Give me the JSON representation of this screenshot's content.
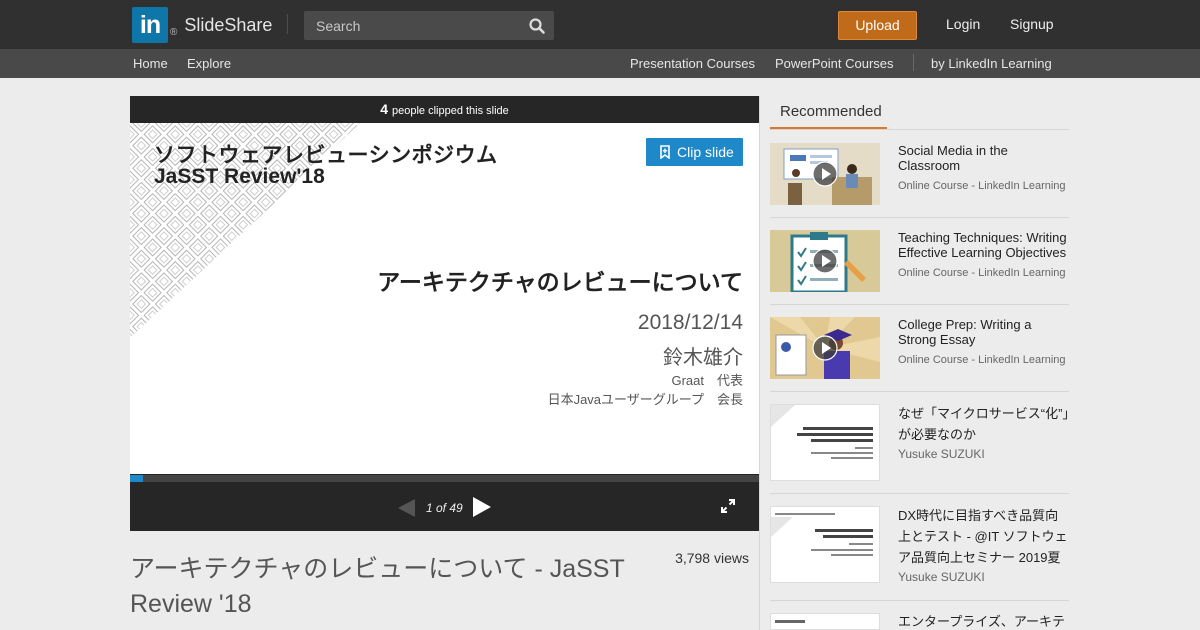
{
  "header": {
    "logo_mark": "in",
    "logo_reg": "®",
    "logo_text": "SlideShare",
    "search_placeholder": "Search",
    "upload_label": "Upload",
    "login_label": "Login",
    "signup_label": "Signup",
    "bg_color": "#303030",
    "upload_color": "#c06b19"
  },
  "subnav": {
    "home": "Home",
    "explore": "Explore",
    "presentation_courses": "Presentation Courses",
    "powerpoint_courses": "PowerPoint Courses",
    "linkedin_learning": "by LinkedIn Learning"
  },
  "player": {
    "clip_count": "4",
    "clip_count_text": "people clipped this slide",
    "clip_button_label": "Clip slide",
    "current_page": 1,
    "total_pages": 49,
    "page_indicator": "1 of 49",
    "progress_fraction": 0.02,
    "accent_color": "#1e88c8",
    "slide": {
      "title_line1": "ソフトウェアレビューシンポジウム",
      "title_line2": "JaSST Review'18",
      "main_title": "アーキテクチャのレビューについて",
      "date": "2018/12/14",
      "author": "鈴木雄介",
      "role1": "Graat　代表",
      "role2": "日本Javaユーザーグループ　会長"
    }
  },
  "document": {
    "title": "アーキテクチャのレビューについて - JaSST Review '18",
    "views": "3,798 views"
  },
  "sidebar": {
    "tab_label": "Recommended",
    "tab_underline_color": "#d9792e",
    "items": [
      {
        "title": "Social Media in the Classroom",
        "subtitle": "Online Course - LinkedIn Learning",
        "thumb_icon": "classroom-illustration"
      },
      {
        "title": "Teaching Techniques: Writing Effective Learning Objectives",
        "subtitle": "Online Course - LinkedIn Learning",
        "thumb_icon": "checklist-illustration"
      },
      {
        "title": "College Prep: Writing a Strong Essay",
        "subtitle": "Online Course - LinkedIn Learning",
        "thumb_icon": "graduate-illustration"
      },
      {
        "title": "なぜ「マイクロサービス“化”」が必要なのか",
        "author": "Yusuke SUZUKI",
        "thumb_icon": "slide-thumbnail"
      },
      {
        "title": "DX時代に目指すべき品質向上とテスト - @IT ソフトウェア品質向上セミナー 2019夏",
        "author": "Yusuke SUZUKI",
        "thumb_icon": "slide-thumbnail"
      },
      {
        "title": "エンタープライズ、アーキテ",
        "thumb_icon": "slide-thumbnail"
      }
    ]
  }
}
